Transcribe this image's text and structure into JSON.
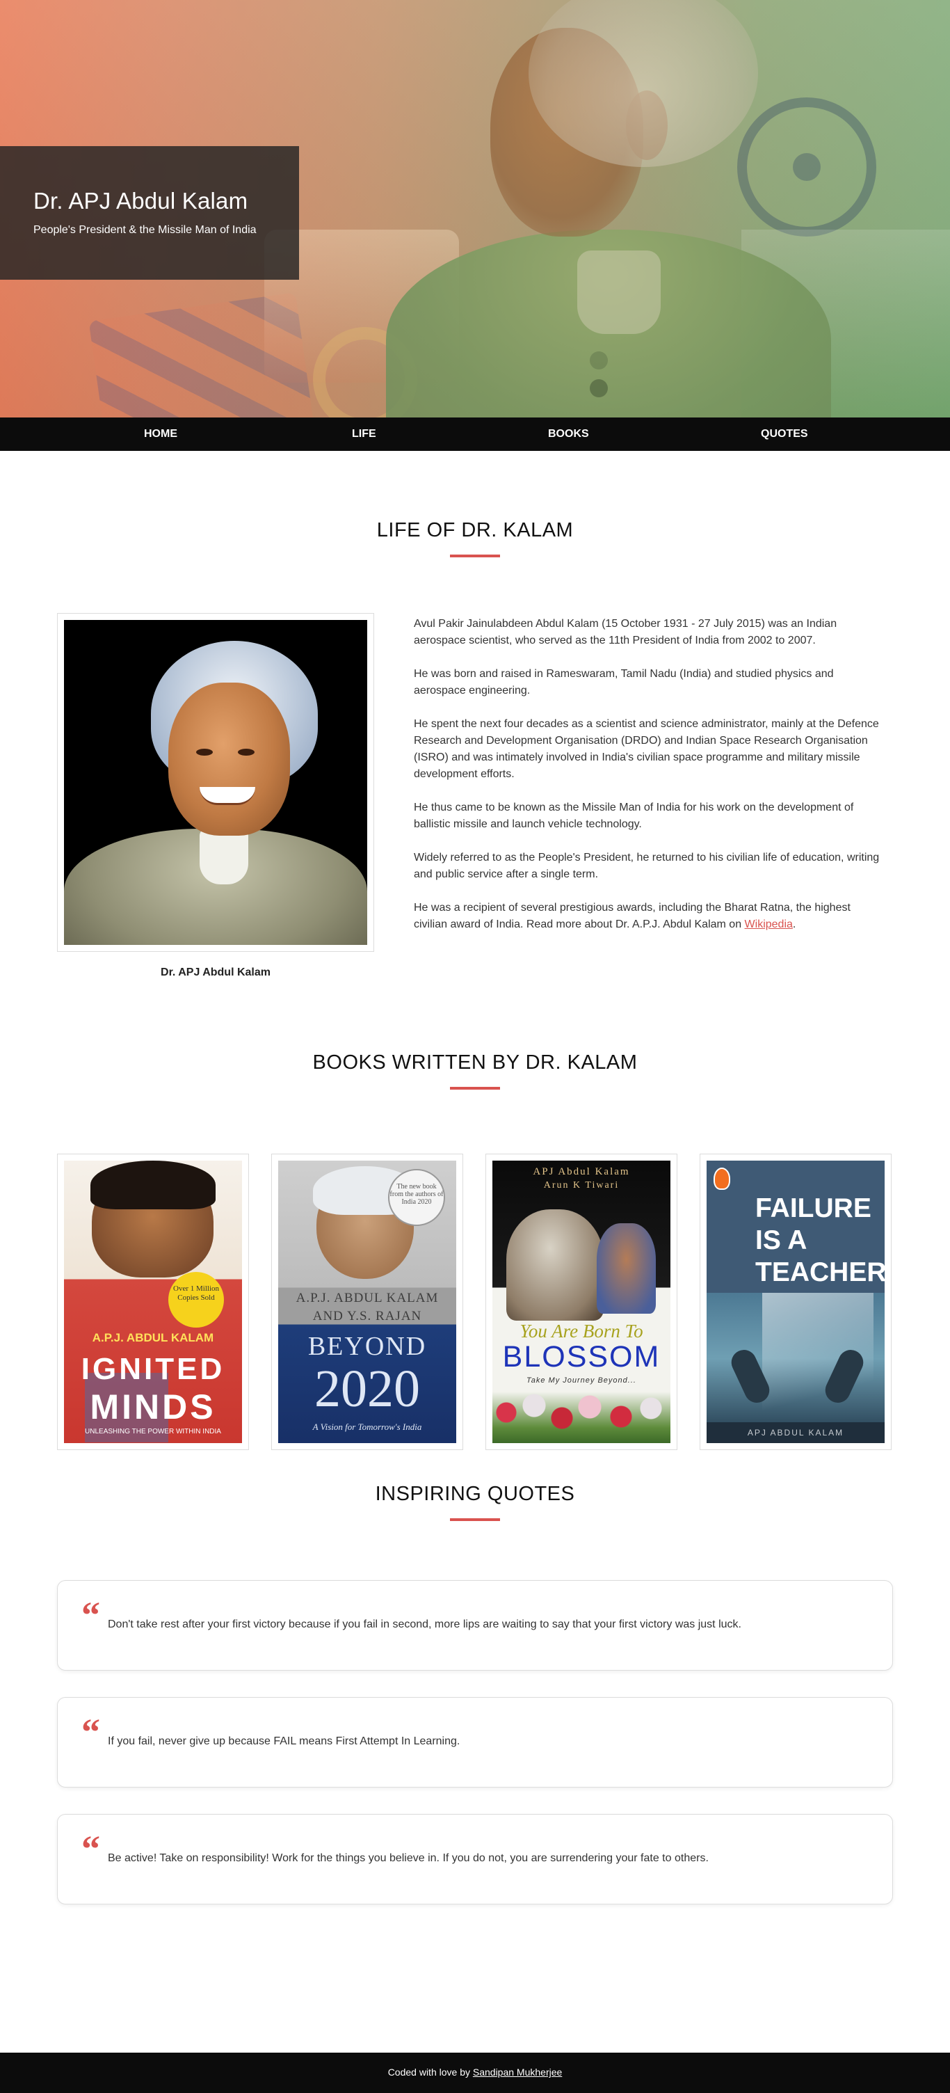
{
  "hero": {
    "title": "Dr. APJ Abdul Kalam",
    "subtitle": "People's President & the Missile Man of India"
  },
  "nav": {
    "items": [
      {
        "label": "HOME"
      },
      {
        "label": "LIFE"
      },
      {
        "label": "BOOKS"
      },
      {
        "label": "QUOTES"
      }
    ]
  },
  "life": {
    "heading": "LIFE OF DR. KALAM",
    "caption": "Dr. APJ Abdul Kalam",
    "paragraphs": [
      "Avul Pakir Jainulabdeen Abdul Kalam (15 October 1931 - 27 July 2015) was an Indian aerospace scientist, who served as the 11th President of India from 2002 to 2007.",
      "He was born and raised in Rameswaram, Tamil Nadu (India) and studied physics and aerospace engineering.",
      "He spent the next four decades as a scientist and science administrator, mainly at the Defence Research and Development Organisation (DRDO) and Indian Space Research Organisation (ISRO) and was intimately involved in India's civilian space programme and military missile development efforts.",
      "He thus came to be known as the Missile Man of India for his work on the development of ballistic missile and launch vehicle technology.",
      "Widely referred to as the People's President, he returned to his civilian life of education, writing and public service after a single term."
    ],
    "last_paragraph_prefix": "He was a recipient of several prestigious awards, including the Bharat Ratna, the highest civilian award of India. Read more about Dr. A.P.J. Abdul Kalam on ",
    "wiki_link": "Wikipedia",
    "last_paragraph_suffix": "."
  },
  "books": {
    "heading": "BOOKS WRITTEN BY DR. KALAM",
    "covers": [
      {
        "author": "A.P.J. ABDUL KALAM",
        "title_line1": "IGNITED",
        "title_line2": "MINDS",
        "subtitle": "UNLEASHING THE POWER WITHIN INDIA",
        "sticker": "Over 1 Million Copies Sold"
      },
      {
        "author_line1": "A.P.J. ABDUL KALAM",
        "author_line2": "AND Y.S. RAJAN",
        "title_line1": "BEYOND",
        "title_line2": "2020",
        "subtitle": "A Vision for Tomorrow's India",
        "seal": "The new book from the authors of India 2020"
      },
      {
        "author_line1": "APJ Abdul Kalam",
        "author_line2": "Arun K Tiwari",
        "title_line1": "You Are Born To",
        "title_line2": "BLOSSOM",
        "subtitle": "Take My Journey Beyond..."
      },
      {
        "title": "FAILURE IS A TEACHER",
        "author": "APJ ABDUL KALAM"
      }
    ]
  },
  "quotes": {
    "heading": "INSPIRING QUOTES",
    "mark": "“",
    "items": [
      {
        "text": "Don't take rest after your first victory because if you fail in second, more lips are waiting to say that your first victory was just luck."
      },
      {
        "text": "If you fail, never give up because FAIL means First Attempt In Learning."
      },
      {
        "text": "Be active! Take on responsibility! Work for the things you believe in. If you do not, you are surrendering your fate to others."
      }
    ]
  },
  "footer": {
    "prefix": "Coded with love by ",
    "author": "Sandipan Mukherjee"
  },
  "colors": {
    "accent": "#d9534f",
    "nav_bg": "#0c0c0c"
  }
}
